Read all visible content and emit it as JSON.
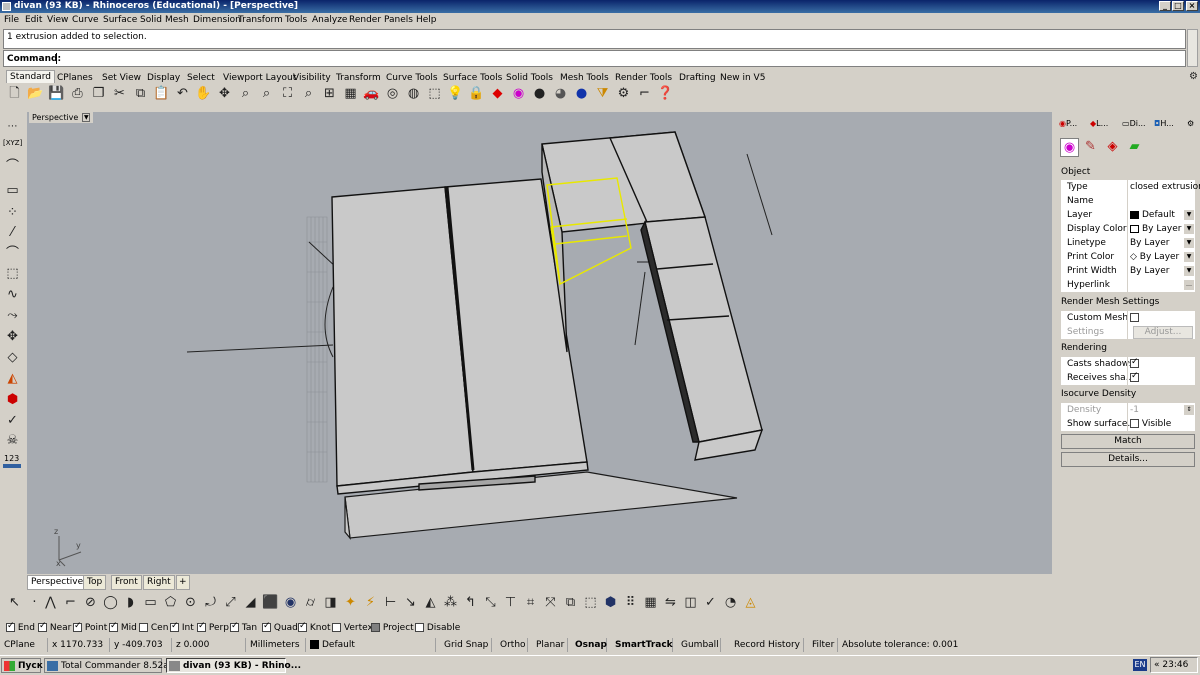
{
  "window": {
    "title": "divan (93 KB) - Rhinoceros (Educational) - [Perspective]"
  },
  "menu": [
    "File",
    "Edit",
    "View",
    "Curve",
    "Surface",
    "Solid",
    "Mesh",
    "Dimension",
    "Transform",
    "Tools",
    "Analyze",
    "Render",
    "Panels",
    "Help"
  ],
  "command": {
    "history": "1 extrusion added to selection.",
    "prompt": "Command:"
  },
  "toolbar_tabs": [
    "Standard",
    "CPlanes",
    "Set View",
    "Display",
    "Select",
    "Viewport Layout",
    "Visibility",
    "Transform",
    "Curve Tools",
    "Surface Tools",
    "Solid Tools",
    "Mesh Tools",
    "Render Tools",
    "Drafting",
    "New in V5"
  ],
  "viewport": {
    "name": "Perspective",
    "axis_labels": {
      "z": "z",
      "y": "y",
      "x": "x"
    }
  },
  "left_toolbar": {
    "xyz_label": "[XYZ]",
    "numbers_label": "123"
  },
  "viewport_tabs": [
    "Perspective",
    "Top",
    "Front",
    "Right"
  ],
  "properties": {
    "tabs": [
      "P...",
      "L...",
      "Di...",
      "H..."
    ],
    "object_header": "Object",
    "rows": [
      {
        "key": "Type",
        "value": "closed extrusion"
      },
      {
        "key": "Name",
        "value": ""
      },
      {
        "key": "Layer",
        "value": "Default"
      },
      {
        "key": "Display Color",
        "value": "By Layer"
      },
      {
        "key": "Linetype",
        "value": "By Layer"
      },
      {
        "key": "Print Color",
        "value": "By Layer"
      },
      {
        "key": "Print Width",
        "value": "By Layer"
      },
      {
        "key": "Hyperlink",
        "value": ""
      }
    ],
    "render_mesh_header": "Render Mesh Settings",
    "custom_mesh_label": "Custom Mesh",
    "settings_label": "Settings",
    "adjust_label": "Adjust...",
    "rendering_header": "Rendering",
    "casts_shadows_label": "Casts shadows",
    "receives_shadows_label": "Receives sha...",
    "isocurve_header": "Isocurve Density",
    "density_label": "Density",
    "density_value": "-1",
    "show_surface_label": "Show surface...",
    "visible_label": "Visible",
    "match_label": "Match",
    "details_label": "Details..."
  },
  "osnap": [
    {
      "label": "End",
      "checked": true
    },
    {
      "label": "Near",
      "checked": true
    },
    {
      "label": "Point",
      "checked": true
    },
    {
      "label": "Mid",
      "checked": true
    },
    {
      "label": "Cen",
      "checked": false
    },
    {
      "label": "Int",
      "checked": true
    },
    {
      "label": "Perp",
      "checked": true
    },
    {
      "label": "Tan",
      "checked": true
    },
    {
      "label": "Quad",
      "checked": true
    },
    {
      "label": "Knot",
      "checked": true
    },
    {
      "label": "Vertex",
      "checked": false
    },
    {
      "label": "Project",
      "checked": false
    },
    {
      "label": "Disable",
      "checked": false
    }
  ],
  "status": {
    "cplane": "CPlane",
    "x": "x 1170.733",
    "y": "y -409.703",
    "z": "z 0.000",
    "units": "Millimeters",
    "layer": "Default",
    "grid_snap": "Grid Snap",
    "ortho": "Ortho",
    "planar": "Planar",
    "osnap": "Osnap",
    "smarttrack": "SmartTrack",
    "gumball": "Gumball",
    "record_history": "Record History",
    "filter": "Filter",
    "tolerance": "Absolute tolerance: 0.001"
  },
  "taskbar": {
    "start": "Пуск",
    "items": [
      "Total Commander 8.52a ...",
      "divan (93 KB) - Rhino..."
    ],
    "lang": "EN",
    "clock": "23:46"
  },
  "colors": {
    "viewport_bg": "#a7abb1",
    "selection": "#e8e800",
    "titlebar": "#0a246a"
  }
}
